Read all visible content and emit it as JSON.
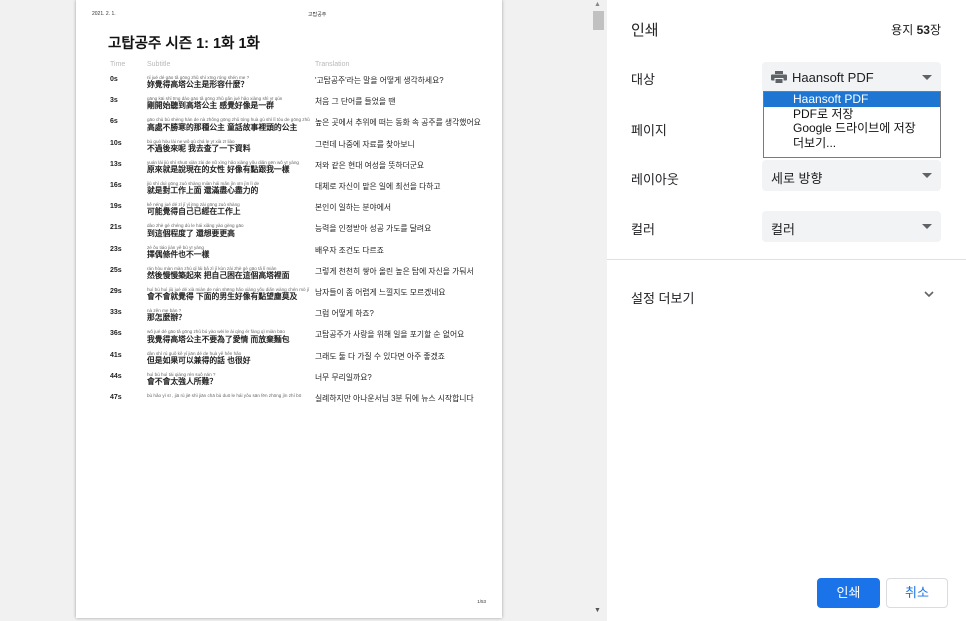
{
  "preview": {
    "header_date": "2021. 2. 1.",
    "header_center": "고탑공주",
    "doc_title": "고탑공주 시즌 1: 1화 1화",
    "columns": {
      "time": "Time",
      "subtitle": "Subtitle",
      "translation": "Translation"
    },
    "rows": [
      {
        "time": "0s",
        "pinyin": "nǐ jué dé gāo tǎ gōng zhǔ shì xīng róng shén me ?",
        "zh": "妳覺得高塔公主是形容什麼？",
        "tr": "'고탑공주'라는 말을 어떻게 생각하세요?"
      },
      {
        "time": "3s",
        "pinyin": "gāng kāi shǐ tīng dào gāo tǎ gōng zhǔ gǎn jué hǎo xiàng shì yī qún",
        "zh": "剛開始聽到高塔公主 感覺好像是一群",
        "tr": "처음 그 단어를 들었을 땐"
      },
      {
        "time": "6s",
        "pinyin": "gāo chù bù shèng hán de nà zhǒng gōng zhǔ tóng huà gù shì lǐ tóu de gōng zhǔ",
        "zh": "高處不勝寒的那種公主 童話故事裡頭的公主",
        "tr": "높은 곳에서 추위에 떠는 동화 속 공주를 생각했어요"
      },
      {
        "time": "10s",
        "pinyin": "bú guò hòu lái ne wǒ qù chá le yī xià zī liào",
        "zh": "不過後來呢 我去查了一下資料",
        "tr": "그런데 나중에 자료를 찾아보니"
      },
      {
        "time": "13s",
        "pinyin": "yuán lái jiù shì shuō xiàn zài de nǚ xìng hǎo xiàng yǒu diǎn gēn wǒ yī yàng",
        "zh": "原來就是說現在的女性 好像有點跟我一樣",
        "tr": "저와 같은 현대 여성을 뜻하더군요"
      },
      {
        "time": "16s",
        "pinyin": "jiù shì duì gōng zuò shàng miàn hái mǎn jìn xīn jìn lì de",
        "zh": "就是對工作上面 還滿盡心盡力的",
        "tr": "대체로 자신이 맡은 일에 최선을 다하고"
      },
      {
        "time": "19s",
        "pinyin": "kě néng jué dé zì jǐ yǐ jīng zài gōng zuò shàng",
        "zh": "可能覺得自己已經在工作上",
        "tr": "본인이 일하는 분야에서"
      },
      {
        "time": "21s",
        "pinyin": "dào zhè gè chéng dù le hái xiǎng yào gèng gāo",
        "zh": "到這個程度了 還想要更高",
        "tr": "능력을 인정받아 성공 가도를 달려요"
      },
      {
        "time": "23s",
        "pinyin": "zé ǒu tiáo jiàn yě bù yī yàng",
        "zh": "擇偶條件也不一樣",
        "tr": "배우자 조건도 다르죠"
      },
      {
        "time": "25s",
        "pinyin": "rán hòu màn màn zhú qǐ lái bǎ zì jǐ kùn zài zhè gè gāo tǎ lǐ miàn",
        "zh": "然後慢慢築起來 把自己困在這個高塔裡面",
        "tr": "그렇게 천천히 쌓아 올린 높은 탑에 자신을 가둬서"
      },
      {
        "time": "29s",
        "pinyin": "huì bú huì jiù jué dé xià miàn de nán shēng hǎo xiàng yǒu diǎn wàng chén mò jí",
        "zh": "會不會就覺得 下面的男生好像有點望塵莫及",
        "tr": "남자들이 좀 어렵게 느낄지도 모르겠네요"
      },
      {
        "time": "33s",
        "pinyin": "nà zěn me bàn ?",
        "zh": "那怎麼辦？",
        "tr": "그럼 어떻게 하죠?"
      },
      {
        "time": "36s",
        "pinyin": "wǒ jué dé gāo tǎ gōng zhǔ bú yào wèi le ài qíng ér fàng qì miàn bāo",
        "zh": "我覺得高塔公主不要為了愛情 而放棄麵包",
        "tr": "고탑공주가 사랑을 위해 일을 포기할 순 없어요"
      },
      {
        "time": "41s",
        "pinyin": "dàn shì rú guǒ kě yǐ jiān dé de huà yě hěn hǎo",
        "zh": "但是如果可以兼得的話 也很好",
        "tr": "그래도 둘 다 가질 수 있다면 아주 좋겠죠"
      },
      {
        "time": "44s",
        "pinyin": "huì bú huì tài qiáng rén suǒ nán ?",
        "zh": "會不會太強人所難？",
        "tr": "너무 무리일까요?"
      },
      {
        "time": "47s",
        "pinyin": "bù hǎo yì sī , jiā rù jiē shì jiān chā bù duō le hái yǒu sān fēn zhōng jìn zhí bō",
        "zh": "",
        "tr": "실례하지만 아나운서님 3분 뒤에 뉴스 시작합니다"
      }
    ],
    "page_number": "1/53"
  },
  "panel": {
    "title": "인쇄",
    "sheets_prefix": "용지 ",
    "sheets_count": "53",
    "sheets_suffix": "장",
    "destination_label": "대상",
    "destination_value": "Haansoft PDF",
    "destination_options": [
      "Haansoft PDF",
      "PDF로 저장",
      "Google 드라이브에 저장",
      "더보기..."
    ],
    "pages_label": "페이지",
    "layout_label": "레이아웃",
    "layout_value": "세로 방향",
    "color_label": "컬러",
    "color_value": "컬러",
    "more_settings": "설정 더보기",
    "print_button": "인쇄",
    "cancel_button": "취소"
  },
  "colors": {
    "accent": "#1a73e8",
    "dropdown_selected": "#1e76d2"
  },
  "icons": {
    "destination": "printer-icon",
    "more_settings": "chevron-down-icon"
  }
}
